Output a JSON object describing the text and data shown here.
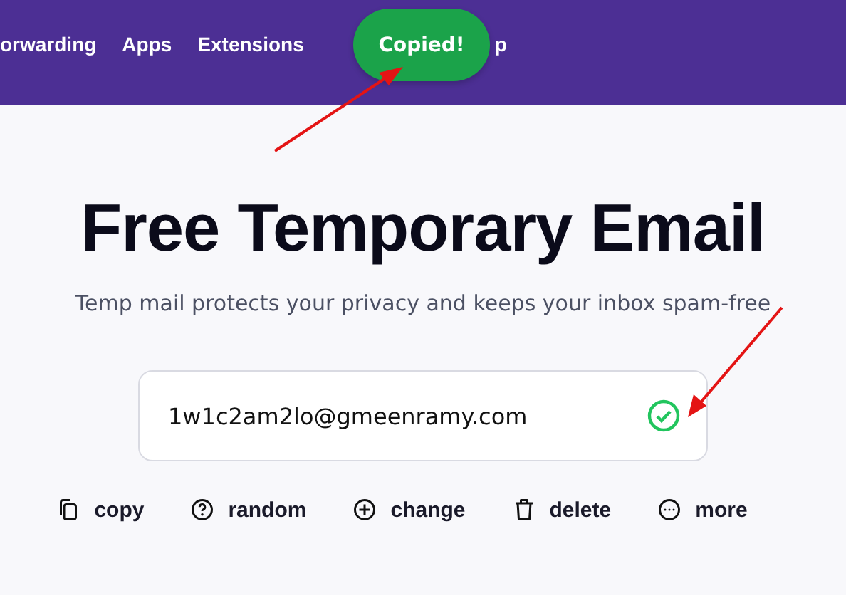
{
  "nav": {
    "items": [
      {
        "label": "orwarding"
      },
      {
        "label": "Apps"
      },
      {
        "label": "Extensions"
      },
      {
        "label": "p"
      }
    ],
    "toast": {
      "text": "Copied!"
    }
  },
  "title": "Free Temporary Email",
  "subtitle": "Temp mail protects your privacy and keeps your inbox spam-free",
  "email": {
    "value": "1w1c2am2lo@gmeenramy.com",
    "verified": true
  },
  "actions": [
    {
      "kind": "copy",
      "label": "copy"
    },
    {
      "kind": "random",
      "label": "random"
    },
    {
      "kind": "change",
      "label": "change"
    },
    {
      "kind": "delete",
      "label": "delete"
    },
    {
      "kind": "more",
      "label": "more"
    }
  ]
}
